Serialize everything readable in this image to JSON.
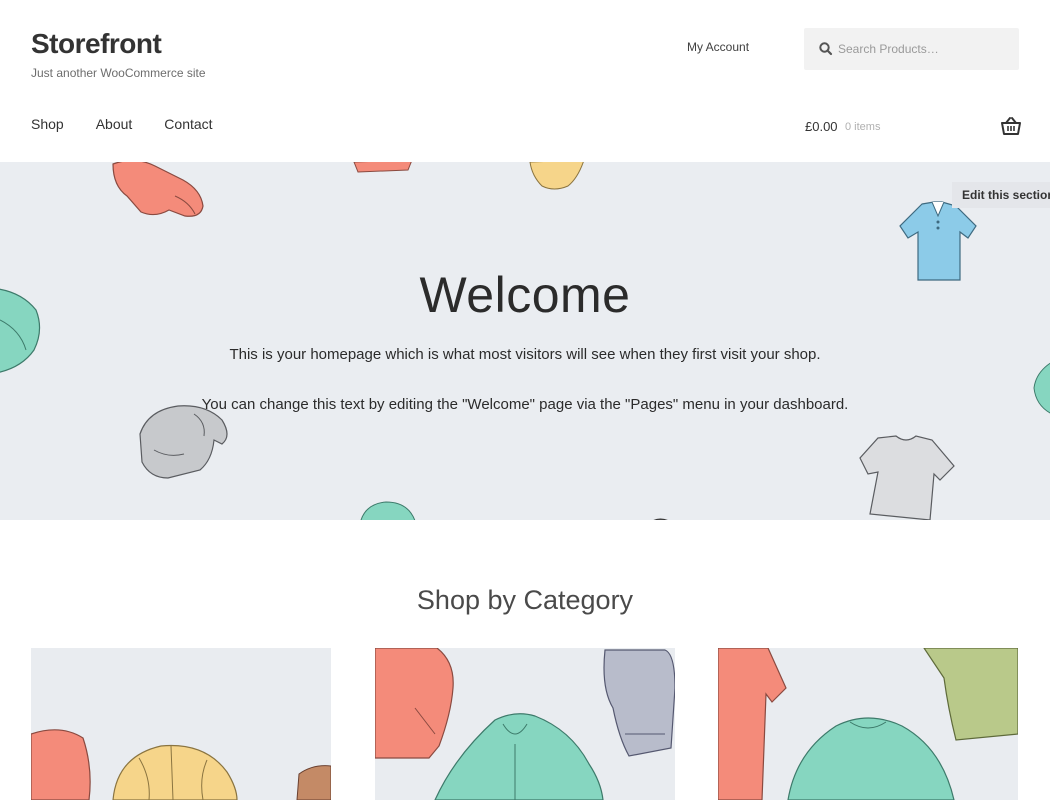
{
  "header": {
    "site_title": "Storefront",
    "tagline": "Just another WooCommerce site",
    "my_account": "My Account",
    "search_placeholder": "Search Products…",
    "search_icon": "search-icon",
    "cart_amount": "£0.00",
    "cart_count": "0 items",
    "cart_icon": "basket-icon"
  },
  "nav": {
    "items": [
      {
        "label": "Shop"
      },
      {
        "label": "About"
      },
      {
        "label": "Contact"
      }
    ]
  },
  "hero": {
    "title": "Welcome",
    "text1": "This is your homepage which is what most visitors will see when they first visit your shop.",
    "text2": "You can change this text by editing the \"Welcome\" page via the \"Pages\" menu in your dashboard.",
    "edit_label": "Edit this section"
  },
  "categories": {
    "title": "Shop by Category"
  },
  "colors": {
    "hero_bg": "#eaedf1",
    "coral": "#f48b7a",
    "mint": "#86d6c0",
    "sky": "#8ccbe8",
    "yellow": "#f6d58a",
    "grey": "#c7c9cc",
    "olive": "#b9c98a",
    "lavender": "#b8bccb"
  }
}
